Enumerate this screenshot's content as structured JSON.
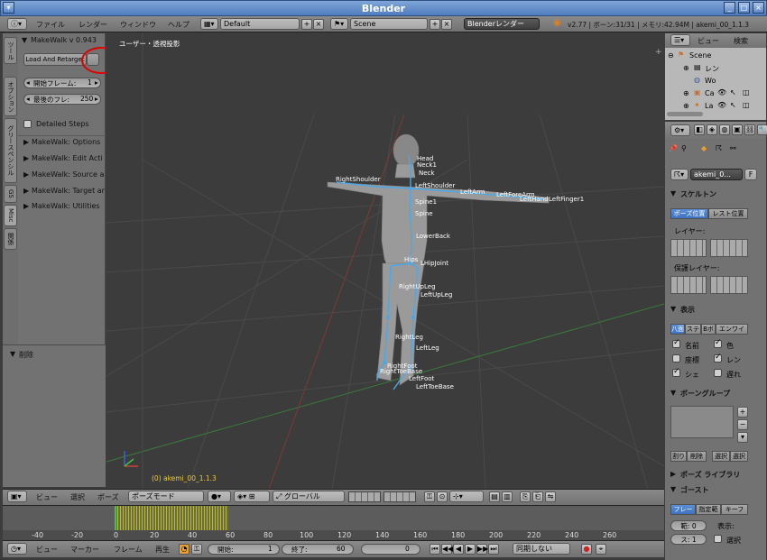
{
  "window": {
    "title": "Blender"
  },
  "info_header": {
    "menus": [
      "ファイル",
      "レンダー",
      "ウィンドウ",
      "ヘルプ"
    ],
    "layout": "Default",
    "scene": "Scene",
    "render_engine": "Blenderレンダー",
    "stats": "v2.77 | ボーン:31/31 | メモリ:42.94M | akemi_00_1.1.3"
  },
  "tool_tabs": [
    "ツール",
    "オプション",
    "グリースペンシル",
    "GS",
    "Misc",
    "関係"
  ],
  "toolshelf": {
    "header": "MakeWalk v 0.943",
    "load_retarget": "Load And Retarget",
    "start_frame_label": "開始フレーム:",
    "start_frame_value": "1",
    "last_frame_label": "最後のフレ:",
    "last_frame_value": "250",
    "detailed_steps": "Detailed Steps",
    "sections": [
      "MakeWalk: Options",
      "MakeWalk: Edit Acti",
      "MakeWalk: Source a",
      "MakeWalk: Target ar",
      "MakeWalk: Utilities"
    ],
    "lower_header": "削除"
  },
  "viewport": {
    "view_label": "ユーザー・透視投影",
    "object_label": "(0) akemi_00_1.1.3",
    "bones": [
      "Head",
      "Neck1",
      "Neck",
      "RightShoulder",
      "LeftShoulder",
      "LeftArm",
      "LeftForeArm",
      "LeftHand",
      "LeftFinger1",
      "Spine1",
      "Spine",
      "LowerBack",
      "Hips",
      "LHipJoint",
      "RightUpLeg",
      "LeftUpLeg",
      "RightLeg",
      "LeftLeg",
      "RightFoot",
      "RightToeBase",
      "LeftFoot",
      "LeftToeBase"
    ]
  },
  "view3d_header": {
    "menus": [
      "ビュー",
      "選択",
      "ポーズ"
    ],
    "mode": "ポーズモード",
    "orientation": "グローバル"
  },
  "timeline": {
    "ticks": [
      "-40",
      "-20",
      "0",
      "20",
      "40",
      "60",
      "80",
      "100",
      "120",
      "140",
      "160",
      "180",
      "200",
      "220",
      "240",
      "260"
    ],
    "menus": [
      "ビュー",
      "マーカー",
      "フレーム",
      "再生"
    ],
    "start_label": "開始:",
    "start_value": "1",
    "end_label": "終了:",
    "end_value": "60",
    "current": "0",
    "sync": "同期しない"
  },
  "outliner": {
    "menus": [
      "ビュー",
      "検索"
    ],
    "items": [
      "Scene",
      "レン",
      "Wo",
      "Ca",
      "La"
    ]
  },
  "properties": {
    "armature_name": "akemi_0...",
    "fake": "F",
    "skeleton_header": "スケルトン",
    "pose_position": "ポーズ位置",
    "rest_position": "レスト位置",
    "layers_label": "レイヤー:",
    "protected_layers_label": "保護レイヤー:",
    "display_header": "表示",
    "display_types": [
      "八面",
      "ステ",
      "Bボ",
      "エンワイ"
    ],
    "options_left": [
      "名前",
      "座標",
      "シェ"
    ],
    "options_right": [
      "色",
      "レン",
      "遅れ"
    ],
    "bone_groups_header": "ボーングループ",
    "assign": "割り",
    "remove": "削除",
    "select": "選択",
    "deselect": "選択",
    "pose_library_header": "ポーズ ライブラリ",
    "ghost_header": "ゴースト",
    "ghost_modes": [
      "フレー",
      "指定範",
      "キーフ"
    ],
    "range_label": "範: 0",
    "step_label": "ス: 1",
    "display_label": "表示:",
    "select_label": "選択"
  }
}
